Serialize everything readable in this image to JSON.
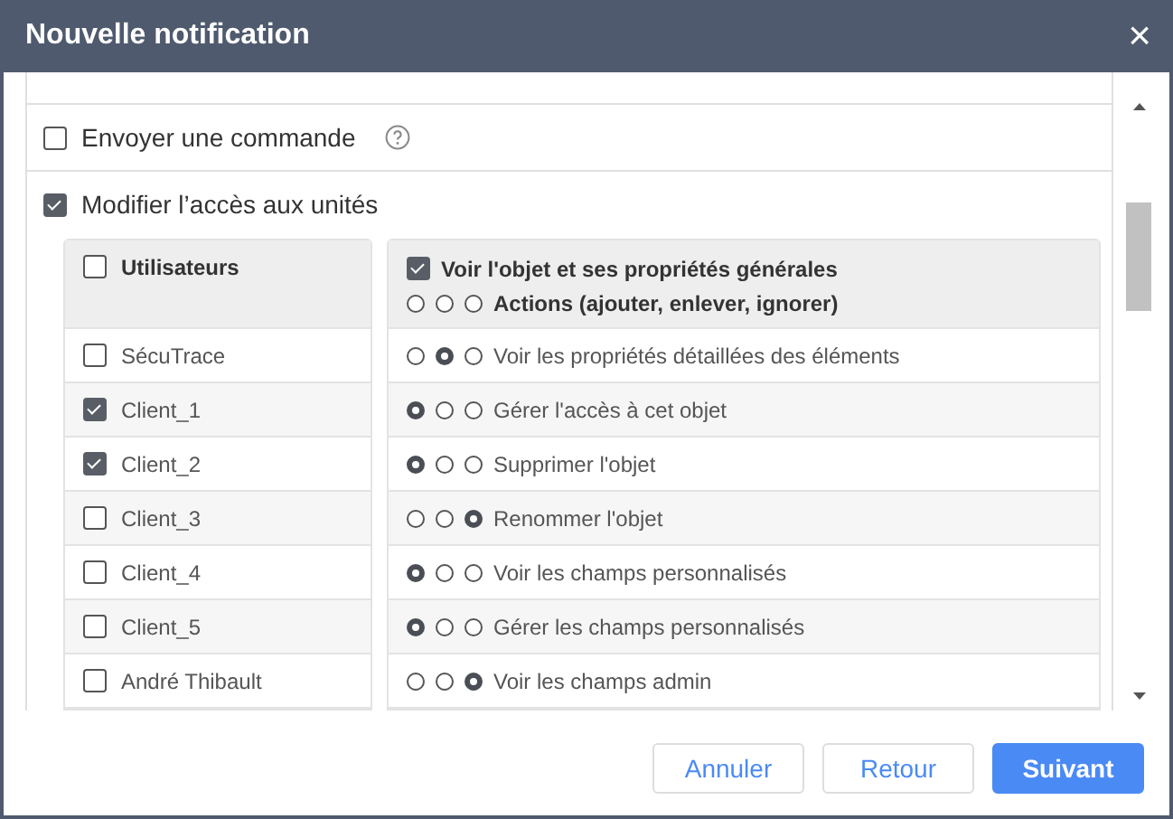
{
  "window": {
    "title": "Nouvelle notification",
    "close": "×"
  },
  "options": [
    {
      "label": "Envoyer une commande",
      "checked": false,
      "help": true
    },
    {
      "label": "Modifier l’accès aux unités",
      "checked": true,
      "help": false
    }
  ],
  "users": {
    "header": {
      "label": "Utilisateurs",
      "checked": false
    },
    "rows": [
      {
        "label": "SécuTrace",
        "checked": false
      },
      {
        "label": "Client_1",
        "checked": true
      },
      {
        "label": "Client_2",
        "checked": true
      },
      {
        "label": "Client_3",
        "checked": false
      },
      {
        "label": "Client_4",
        "checked": false
      },
      {
        "label": "Client_5",
        "checked": false
      },
      {
        "label": "André Thibault",
        "checked": false
      }
    ]
  },
  "rights": {
    "header": {
      "label": "Voir l'objet et ses propriétés générales",
      "checked": true
    },
    "actions": {
      "label": "Actions (ajouter, enlever, ignorer)",
      "radios": [
        {
          "selected": false
        },
        {
          "selected": false
        },
        {
          "selected": false
        }
      ]
    },
    "rows": [
      {
        "label": "Voir les propriétés détaillées des éléments",
        "radios": [
          {
            "selected": false
          },
          {
            "selected": true
          },
          {
            "selected": false
          }
        ]
      },
      {
        "label": "Gérer l'accès à cet objet",
        "radios": [
          {
            "selected": true
          },
          {
            "selected": false
          },
          {
            "selected": false
          }
        ]
      },
      {
        "label": "Supprimer l'objet",
        "radios": [
          {
            "selected": true
          },
          {
            "selected": false
          },
          {
            "selected": false
          }
        ]
      },
      {
        "label": "Renommer l'objet",
        "radios": [
          {
            "selected": false
          },
          {
            "selected": false
          },
          {
            "selected": true
          }
        ]
      },
      {
        "label": "Voir les champs personnalisés",
        "radios": [
          {
            "selected": true
          },
          {
            "selected": false
          },
          {
            "selected": false
          }
        ]
      },
      {
        "label": "Gérer les champs personnalisés",
        "radios": [
          {
            "selected": true
          },
          {
            "selected": false
          },
          {
            "selected": false
          }
        ]
      },
      {
        "label": "Voir les champs admin",
        "radios": [
          {
            "selected": false
          },
          {
            "selected": false
          },
          {
            "selected": true
          }
        ]
      }
    ]
  },
  "buttons": [
    {
      "label": "Annuler",
      "kind": "secondary"
    },
    {
      "label": "Retour",
      "kind": "secondary"
    },
    {
      "label": "Suivant",
      "kind": "primary"
    }
  ]
}
